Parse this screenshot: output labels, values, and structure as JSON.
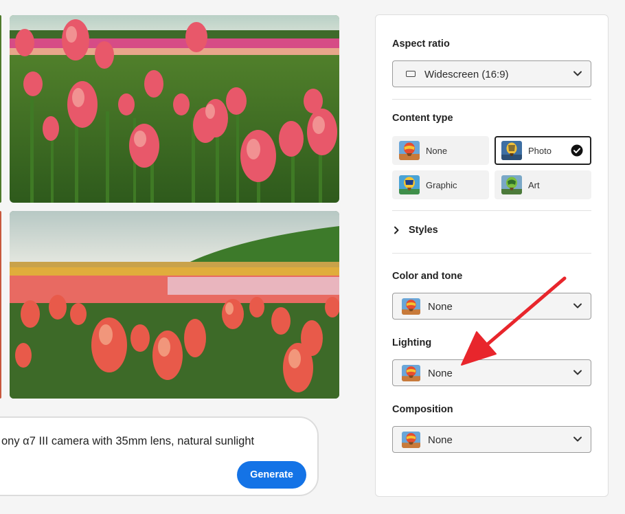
{
  "prompt": {
    "text": "ony α7 III camera with 35mm lens, natural sunlight",
    "generate_label": "Generate"
  },
  "panel": {
    "aspect_ratio": {
      "title": "Aspect ratio",
      "value": "Widescreen (16:9)"
    },
    "content_type": {
      "title": "Content type",
      "options": [
        {
          "label": "None",
          "selected": false
        },
        {
          "label": "Photo",
          "selected": true
        },
        {
          "label": "Graphic",
          "selected": false
        },
        {
          "label": "Art",
          "selected": false
        }
      ]
    },
    "styles": {
      "label": "Styles"
    },
    "color_and_tone": {
      "title": "Color and tone",
      "value": "None"
    },
    "lighting": {
      "title": "Lighting",
      "value": "None"
    },
    "composition": {
      "title": "Composition",
      "value": "None"
    }
  },
  "colors": {
    "accent": "#1473e6",
    "annotation_arrow": "#e8262c"
  }
}
